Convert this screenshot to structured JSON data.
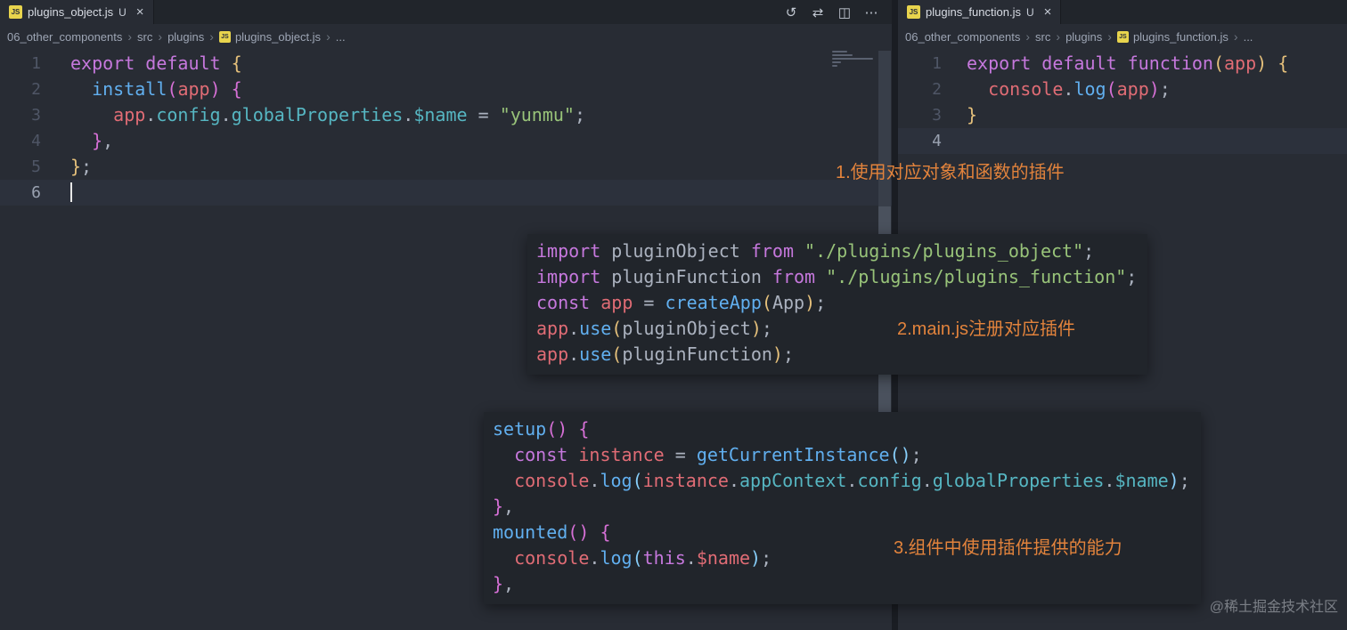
{
  "theme": {
    "editor_bg": "#282c34",
    "tabbar_bg": "#21252b",
    "tab_active_bg": "#282c34",
    "overlay_bg": "#21252b",
    "current_line_bg": "#2c313c",
    "annotation_color": "#e2833c",
    "token_colors": {
      "kw": "#c678dd",
      "fn": "#61afef",
      "rd": "#e06c75",
      "cy": "#56b6c2",
      "st": "#98c379",
      "d": "#abb2bf",
      "b1": "#e5c07b",
      "b2": "#d670d6",
      "b3": "#87cefa"
    }
  },
  "left_editor": {
    "tab": {
      "label": "plugins_object.js",
      "modified": "U",
      "close": "×"
    },
    "actions": [
      {
        "name": "history-icon",
        "glyph": "↺"
      },
      {
        "name": "open-changes-icon",
        "glyph": "⇄"
      },
      {
        "name": "split-editor-icon",
        "glyph": "◫"
      },
      {
        "name": "more-actions-icon",
        "glyph": "⋯"
      }
    ],
    "breadcrumb": [
      {
        "label": "06_other_components"
      },
      {
        "label": "src"
      },
      {
        "label": "plugins"
      },
      {
        "label": "plugins_object.js",
        "icon": "js"
      },
      {
        "label": "..."
      }
    ],
    "cursor_line": 6,
    "code": [
      [
        [
          "kw",
          "export"
        ],
        [
          "d",
          " "
        ],
        [
          "kw",
          "default"
        ],
        [
          "d",
          " "
        ],
        [
          "b1",
          "{"
        ]
      ],
      [
        [
          "d",
          "  "
        ],
        [
          "fn",
          "install"
        ],
        [
          "b2",
          "("
        ],
        [
          "rd",
          "app"
        ],
        [
          "b2",
          ")"
        ],
        [
          "d",
          " "
        ],
        [
          "b2",
          "{"
        ]
      ],
      [
        [
          "d",
          "    "
        ],
        [
          "rd",
          "app"
        ],
        [
          "d",
          "."
        ],
        [
          "cy",
          "config"
        ],
        [
          "d",
          "."
        ],
        [
          "cy",
          "globalProperties"
        ],
        [
          "d",
          "."
        ],
        [
          "cy",
          "$name"
        ],
        [
          "d",
          " = "
        ],
        [
          "st",
          "\"yunmu\""
        ],
        [
          "d",
          ";"
        ]
      ],
      [
        [
          "d",
          "  "
        ],
        [
          "b2",
          "}"
        ],
        [
          "d",
          ","
        ]
      ],
      [
        [
          "b1",
          "}"
        ],
        [
          "d",
          ";"
        ]
      ],
      []
    ]
  },
  "right_editor": {
    "tab": {
      "label": "plugins_function.js",
      "modified": "U",
      "close": "×"
    },
    "breadcrumb": [
      {
        "label": "06_other_components"
      },
      {
        "label": "src"
      },
      {
        "label": "plugins"
      },
      {
        "label": "plugins_function.js",
        "icon": "js"
      },
      {
        "label": "..."
      }
    ],
    "active_line": 4,
    "code": [
      [
        [
          "kw",
          "export"
        ],
        [
          "d",
          " "
        ],
        [
          "kw",
          "default"
        ],
        [
          "d",
          " "
        ],
        [
          "kw",
          "function"
        ],
        [
          "b1",
          "("
        ],
        [
          "rd",
          "app"
        ],
        [
          "b1",
          ")"
        ],
        [
          "d",
          " "
        ],
        [
          "b1",
          "{"
        ]
      ],
      [
        [
          "d",
          "  "
        ],
        [
          "rd",
          "console"
        ],
        [
          "d",
          "."
        ],
        [
          "fn",
          "log"
        ],
        [
          "b2",
          "("
        ],
        [
          "rd",
          "app"
        ],
        [
          "b2",
          ")"
        ],
        [
          "d",
          ";"
        ]
      ],
      [
        [
          "b1",
          "}"
        ]
      ],
      []
    ]
  },
  "overlays": [
    {
      "name": "main-js-snippet",
      "lines": [
        [
          [
            "kw",
            "import"
          ],
          [
            "d",
            " pluginObject "
          ],
          [
            "kw",
            "from"
          ],
          [
            "d",
            " "
          ],
          [
            "st",
            "\"./plugins/plugins_object\""
          ],
          [
            "d",
            ";"
          ]
        ],
        [
          [
            "kw",
            "import"
          ],
          [
            "d",
            " pluginFunction "
          ],
          [
            "kw",
            "from"
          ],
          [
            "d",
            " "
          ],
          [
            "st",
            "\"./plugins/plugins_function\""
          ],
          [
            "d",
            ";"
          ]
        ],
        [
          [
            "kw",
            "const"
          ],
          [
            "d",
            " "
          ],
          [
            "rd",
            "app"
          ],
          [
            "d",
            " = "
          ],
          [
            "fn",
            "createApp"
          ],
          [
            "b1",
            "("
          ],
          [
            "d",
            "App"
          ],
          [
            "b1",
            ")"
          ],
          [
            "d",
            ";"
          ]
        ],
        [
          [
            "rd",
            "app"
          ],
          [
            "d",
            "."
          ],
          [
            "fn",
            "use"
          ],
          [
            "b1",
            "("
          ],
          [
            "d",
            "pluginObject"
          ],
          [
            "b1",
            ")"
          ],
          [
            "d",
            ";"
          ]
        ],
        [
          [
            "rd",
            "app"
          ],
          [
            "d",
            "."
          ],
          [
            "fn",
            "use"
          ],
          [
            "b1",
            "("
          ],
          [
            "d",
            "pluginFunction"
          ],
          [
            "b1",
            ")"
          ],
          [
            "d",
            ";"
          ]
        ]
      ]
    },
    {
      "name": "component-snippet",
      "lines": [
        [
          [
            "fn",
            "setup"
          ],
          [
            "b2",
            "()"
          ],
          [
            "d",
            " "
          ],
          [
            "b2",
            "{"
          ]
        ],
        [
          [
            "d",
            "  "
          ],
          [
            "kw",
            "const"
          ],
          [
            "d",
            " "
          ],
          [
            "rd",
            "instance"
          ],
          [
            "d",
            " = "
          ],
          [
            "fn",
            "getCurrentInstance"
          ],
          [
            "b3",
            "()"
          ],
          [
            "d",
            ";"
          ]
        ],
        [
          [
            "d",
            "  "
          ],
          [
            "rd",
            "console"
          ],
          [
            "d",
            "."
          ],
          [
            "fn",
            "log"
          ],
          [
            "b3",
            "("
          ],
          [
            "rd",
            "instance"
          ],
          [
            "d",
            "."
          ],
          [
            "cy",
            "appContext"
          ],
          [
            "d",
            "."
          ],
          [
            "cy",
            "config"
          ],
          [
            "d",
            "."
          ],
          [
            "cy",
            "globalProperties"
          ],
          [
            "d",
            "."
          ],
          [
            "cy",
            "$name"
          ],
          [
            "b3",
            ")"
          ],
          [
            "d",
            ";"
          ]
        ],
        [
          [
            "b2",
            "}"
          ],
          [
            "d",
            ","
          ]
        ],
        [
          [
            "fn",
            "mounted"
          ],
          [
            "b2",
            "()"
          ],
          [
            "d",
            " "
          ],
          [
            "b2",
            "{"
          ]
        ],
        [
          [
            "d",
            "  "
          ],
          [
            "rd",
            "console"
          ],
          [
            "d",
            "."
          ],
          [
            "fn",
            "log"
          ],
          [
            "b3",
            "("
          ],
          [
            "kw",
            "this"
          ],
          [
            "d",
            "."
          ],
          [
            "rd",
            "$name"
          ],
          [
            "b3",
            ")"
          ],
          [
            "d",
            ";"
          ]
        ],
        [
          [
            "b2",
            "}"
          ],
          [
            "d",
            ","
          ]
        ]
      ]
    }
  ],
  "annotations": [
    {
      "text": "1.使用对应对象和函数的插件"
    },
    {
      "text": "2.main.js注册对应插件"
    },
    {
      "text": "3.组件中使用插件提供的能力"
    }
  ],
  "watermark": "@稀土掘金技术社区"
}
